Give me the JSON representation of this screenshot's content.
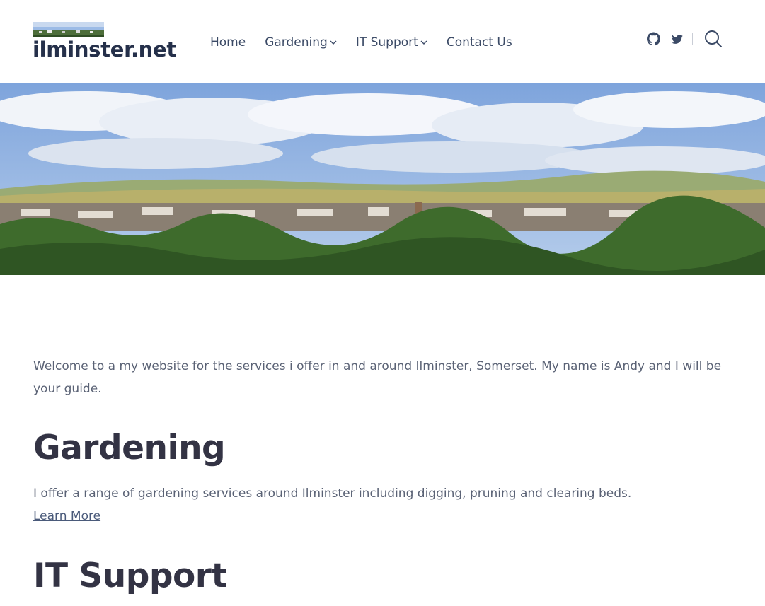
{
  "site": {
    "title": "ilminster.net"
  },
  "nav": {
    "items": [
      {
        "label": "Home",
        "has_dropdown": false
      },
      {
        "label": "Gardening",
        "has_dropdown": true
      },
      {
        "label": "IT Support",
        "has_dropdown": true
      },
      {
        "label": "Contact Us",
        "has_dropdown": false
      }
    ]
  },
  "social": {
    "icons": [
      "github-icon",
      "twitter-icon"
    ],
    "search_icon": "search-icon"
  },
  "main": {
    "intro": "Welcome to a my website for the services i offer in and around Ilminster, Somerset. My name is Andy and I will be your guide.",
    "sections": [
      {
        "heading": "Gardening",
        "text": "I offer a range of gardening services around Ilminster including digging, pruning and clearing beds.",
        "link": "Learn More"
      },
      {
        "heading": "IT Support"
      }
    ]
  },
  "colors": {
    "title": "#25304a",
    "nav": "#3b4a66",
    "heading": "#333344",
    "body_text": "#5a6275",
    "sky": "#8fb2e0",
    "trees": "#3e6b2c"
  }
}
